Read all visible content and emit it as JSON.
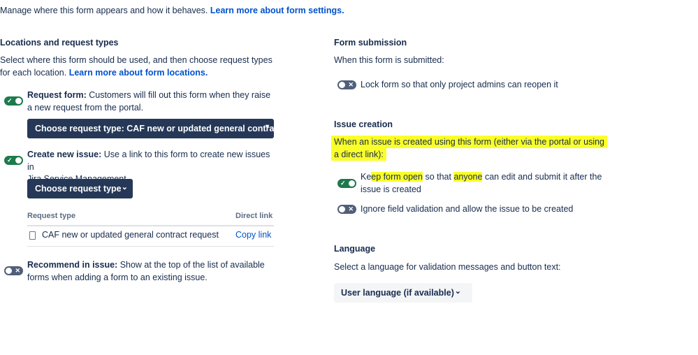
{
  "intro": {
    "text": "Manage where this form appears and how it behaves.",
    "link": "Learn more about form settings."
  },
  "locations": {
    "title": "Locations and request types",
    "desc_line1": "Select where this form should be used, and then choose request types",
    "desc_line2": "for each location.",
    "desc_link": "Learn more about form locations.",
    "request_form": {
      "enabled": true,
      "label": "Request form:",
      "desc_line1": "Customers will fill out this form when they raise",
      "desc_line2": "a new request from the portal.",
      "dropdown_label": "Choose request type: CAF new or updated general contra"
    },
    "create_issue": {
      "enabled": true,
      "label": "Create new issue:",
      "desc_line1": "Use a link to this form to create new issues in",
      "desc_line2": "Jira Service Management.",
      "dropdown_label": "Choose request type"
    },
    "table": {
      "col_request_type": "Request type",
      "col_direct_link": "Direct link",
      "rows": [
        {
          "request_type": "CAF new or updated general contract request",
          "action": "Copy link"
        }
      ]
    },
    "recommend": {
      "enabled": false,
      "label": "Recommend in issue:",
      "desc_line1": "Show at the top of the list of available",
      "desc_line2": "forms when adding a form to an existing issue."
    }
  },
  "form_submission": {
    "title": "Form submission",
    "desc": "When this form is submitted:",
    "lock": {
      "enabled": false,
      "label": "Lock form so that only project admins can reopen it"
    }
  },
  "issue_creation": {
    "title": "Issue creation",
    "desc_line1": "When an issue is created using this form (either via the portal or using",
    "desc_line2": "a direct link):",
    "keep_open": {
      "enabled": true,
      "label_line1_a": "Ke",
      "label_line1_b": "ep form open",
      "label_line1_c": " so that ",
      "label_line1_d": "anyone",
      "label_line1_e": " can edit and submit it after the",
      "label_line2_a": "issue is created"
    },
    "ignore_validation": {
      "enabled": false,
      "label": "Ignore field validation and allow the issue to be created"
    }
  },
  "language": {
    "title": "Language",
    "desc": "Select a language for validation messages and button text:",
    "selected": "User language (if available)"
  },
  "colors": {
    "toggle_on": "#1e7a4d",
    "toggle_off": "#505f79",
    "dark_button": "#253858",
    "link": "#0052cc",
    "highlight": "#fbff29"
  },
  "icons": {
    "toggle_on": "check-icon",
    "toggle_off": "cross-icon",
    "dropdown": "chevron-down-icon",
    "row": "form-document-icon"
  }
}
